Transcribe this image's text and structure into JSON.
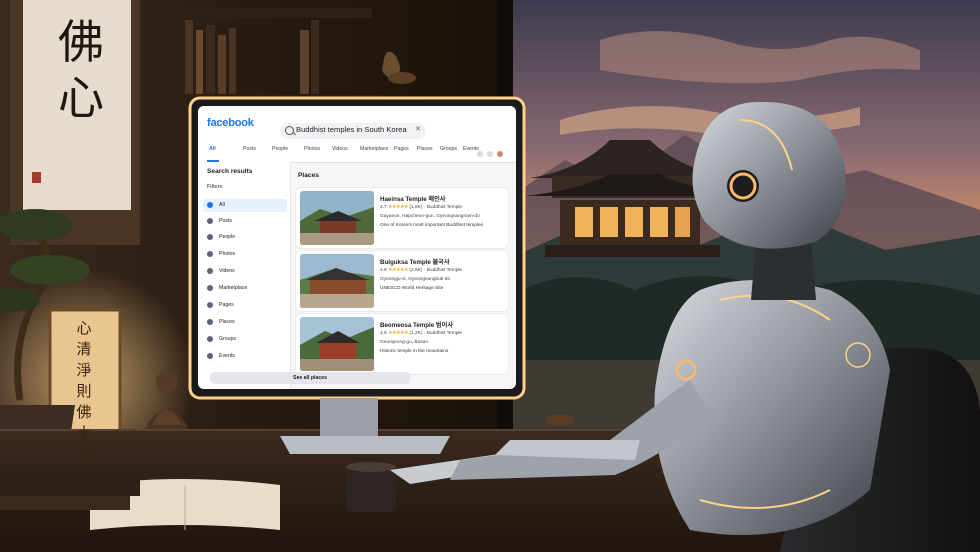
{
  "scene": {
    "scroll_characters": [
      "佛",
      "心"
    ],
    "lantern_characters": "心清淨則佛土淨",
    "colors": {
      "sky_top": "#3b3a4a",
      "sunset": "#f2a35f",
      "wall": "#2a1e16",
      "desk": "#2e2119",
      "robot": "#b8bcc2",
      "glow": "#ffd08a"
    }
  },
  "facebook": {
    "logo": "facebook",
    "search_query": "Buddhist temples in South Korea",
    "tabs": [
      "All",
      "Posts",
      "People",
      "Photos",
      "Videos",
      "Marketplace",
      "Pages",
      "Places",
      "Groups",
      "Events"
    ],
    "active_tab": "All",
    "sidebar": {
      "title": "Search results",
      "filters_label": "Filters",
      "items": [
        {
          "label": "All",
          "icon": "search-icon",
          "active": true
        },
        {
          "label": "Posts",
          "icon": "posts-icon"
        },
        {
          "label": "People",
          "icon": "people-icon"
        },
        {
          "label": "Photos",
          "icon": "photos-icon"
        },
        {
          "label": "Videos",
          "icon": "videos-icon"
        },
        {
          "label": "Marketplace",
          "icon": "marketplace-icon"
        },
        {
          "label": "Pages",
          "icon": "pages-icon"
        },
        {
          "label": "Places",
          "icon": "pin-icon"
        },
        {
          "label": "Groups",
          "icon": "groups-icon"
        },
        {
          "label": "Events",
          "icon": "events-icon"
        }
      ]
    },
    "places_title": "Places",
    "places": [
      {
        "name": "Haeinsa Temple 해인사",
        "rating": "4.7",
        "stars": "★★★★★",
        "reviews": "(1.6K)",
        "category": "Buddhist Temple",
        "location": "Gayaeun, Hapcheon-gun, Gyeongsangnam-do",
        "desc": "One of Korea's most important Buddhist temples"
      },
      {
        "name": "Bulguksa Temple 불국사",
        "rating": "4.8",
        "stars": "★★★★★",
        "reviews": "(2.6K)",
        "category": "Buddhist Temple",
        "location": "Gyeongju-si, Gyeongsangbuk-do",
        "desc": "UNESCO World Heritage Site"
      },
      {
        "name": "Beomeosa Temple 범어사",
        "rating": "4.6",
        "stars": "★★★★★",
        "reviews": "(1.2K)",
        "category": "Buddhist Temple",
        "location": "Geumjeong-gu, Busan",
        "desc": "Historic temple in the mountains"
      }
    ],
    "see_all": "See all places"
  }
}
